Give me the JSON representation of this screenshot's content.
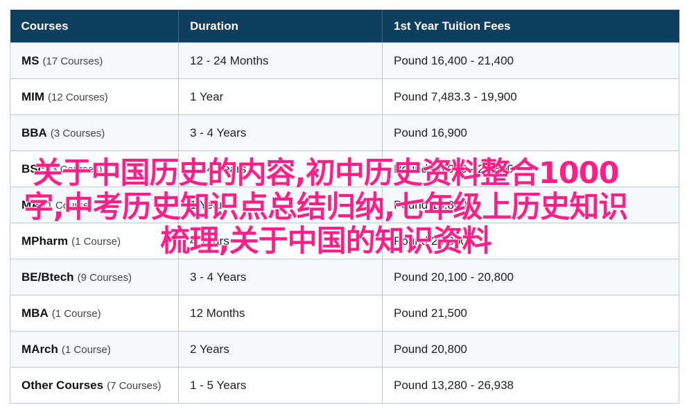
{
  "table": {
    "headers": [
      "Courses",
      "Duration",
      "1st Year Tuition Fees"
    ],
    "rows": [
      {
        "name": "MS",
        "count": "(17 Courses)",
        "duration": "12 - 24 Months",
        "fees": "Pound 16,400 - 21,400"
      },
      {
        "name": "MIM",
        "count": "(12 Courses)",
        "duration": "1 Year",
        "fees": "Pound 7,483.3 - 19,900"
      },
      {
        "name": "BBA",
        "count": "(3 Courses)",
        "duration": "3 - 4 Years",
        "fees": "Pound 16,900"
      },
      {
        "name": "BSc",
        "count": "(3 Courses)",
        "duration": "3 - 4 Years",
        "fees": "Pound 16,900 - 20,800"
      },
      {
        "name": "MA",
        "count": "(1 Course)",
        "duration": "1 Year",
        "fees": "Pound 16,800"
      },
      {
        "name": "MPharm",
        "count": "(1 Course)",
        "duration": "4 Years",
        "fees": "Pound 20,800"
      },
      {
        "name": "BE/Btech",
        "count": "(9 Courses)",
        "duration": "3 - 4 Years",
        "fees": "Pound 20,100 - 20,800"
      },
      {
        "name": "MBA",
        "count": "(1 Course)",
        "duration": "12 Months",
        "fees": "Pound 21,500"
      },
      {
        "name": "MArch",
        "count": "(1 Course)",
        "duration": "2 Years",
        "fees": "Pound 20,800"
      },
      {
        "name": "Other Courses",
        "count": "(7 Courses)",
        "duration": "1 - 5 Years",
        "fees": "Pound 13,280 - 26,938"
      }
    ]
  },
  "overlay": {
    "text": "关于中国历史的内容,初中历史资料整合1000字,中考历史知识点总结归纳,七年级上历史知识梳理,关于中国的知识资料"
  },
  "colors": {
    "header_bg": "#0e3f5e",
    "overlay_text": "#ff1f87"
  }
}
